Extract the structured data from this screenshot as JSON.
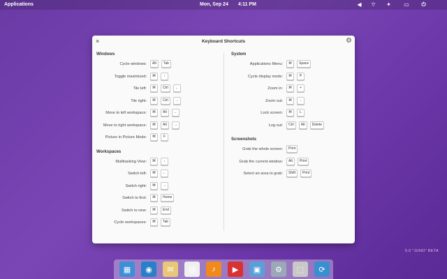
{
  "panel": {
    "applications": "Applications",
    "date": "Mon, Sep 24",
    "time": "4:11 PM"
  },
  "dialog": {
    "title": "Keyboard Shortcuts",
    "left_sections": [
      {
        "title": "Windows",
        "rows": [
          {
            "label": "Cycle windows:",
            "keys": [
              "Alt",
              "Tab"
            ]
          },
          {
            "label": "Toggle maximized:",
            "keys": [
              "⌘",
              "↑"
            ]
          },
          {
            "label": "Tile left:",
            "keys": [
              "⌘",
              "Ctrl",
              "←"
            ]
          },
          {
            "label": "Tile right:",
            "keys": [
              "⌘",
              "Ctrl",
              "→"
            ]
          },
          {
            "label": "Move to left workspace:",
            "keys": [
              "⌘",
              "Alt",
              "←"
            ]
          },
          {
            "label": "Move to right workspace:",
            "keys": [
              "⌘",
              "Alt",
              "→"
            ]
          },
          {
            "label": "Picture in Picture Mode:",
            "keys": [
              "⌘",
              "F"
            ]
          }
        ]
      },
      {
        "title": "Workspaces",
        "rows": [
          {
            "label": "Multitasking View:",
            "keys": [
              "⌘",
              "↓"
            ]
          },
          {
            "label": "Switch left:",
            "keys": [
              "⌘",
              "←"
            ]
          },
          {
            "label": "Switch right:",
            "keys": [
              "⌘",
              "→"
            ]
          },
          {
            "label": "Switch to first:",
            "keys": [
              "⌘",
              "Home"
            ]
          },
          {
            "label": "Switch to new:",
            "keys": [
              "⌘",
              "End"
            ]
          },
          {
            "label": "Cycle workspaces:",
            "keys": [
              "⌘",
              "Tab"
            ]
          }
        ]
      }
    ],
    "right_sections": [
      {
        "title": "System",
        "rows": [
          {
            "label": "Applications Menu:",
            "keys": [
              "⌘",
              "Space"
            ]
          },
          {
            "label": "Cycle display mode:",
            "keys": [
              "⌘",
              "P"
            ]
          },
          {
            "label": "Zoom in:",
            "keys": [
              "⌘",
              "+"
            ]
          },
          {
            "label": "Zoom out:",
            "keys": [
              "⌘",
              "-"
            ]
          },
          {
            "label": "Lock screen:",
            "keys": [
              "⌘",
              "L"
            ]
          },
          {
            "label": "Log out:",
            "keys": [
              "Ctrl",
              "Alt",
              "Delete"
            ]
          }
        ]
      },
      {
        "title": "Screenshots",
        "rows": [
          {
            "label": "Grab the whole screen:",
            "keys": [
              "Print"
            ]
          },
          {
            "label": "Grab the current window:",
            "keys": [
              "Alt",
              "Print"
            ]
          },
          {
            "label": "Select an area to grab:",
            "keys": [
              "Shift",
              "Print"
            ]
          }
        ]
      }
    ]
  },
  "watermark": "5.0 \"JUNO\" BETA",
  "dock": [
    {
      "name": "multitasking-view-icon",
      "color": "#3d8fd6",
      "glyph": "▦"
    },
    {
      "name": "web-browser-icon",
      "color": "#2a7fc9",
      "glyph": "◉"
    },
    {
      "name": "mail-icon",
      "color": "#e8c878",
      "glyph": "✉"
    },
    {
      "name": "calendar-icon",
      "color": "#f0f0f0",
      "glyph": "▤"
    },
    {
      "name": "music-icon",
      "color": "#f08a1c",
      "glyph": "♪"
    },
    {
      "name": "videos-icon",
      "color": "#d93232",
      "glyph": "▶"
    },
    {
      "name": "photos-icon",
      "color": "#5aa0d8",
      "glyph": "▣"
    },
    {
      "name": "system-settings-icon",
      "color": "#9aa8b8",
      "glyph": "⚙"
    },
    {
      "name": "appcenter-icon",
      "color": "#c8c8c8",
      "glyph": "⬚"
    },
    {
      "name": "updates-icon",
      "color": "#3a8fd0",
      "glyph": "⟳"
    }
  ]
}
